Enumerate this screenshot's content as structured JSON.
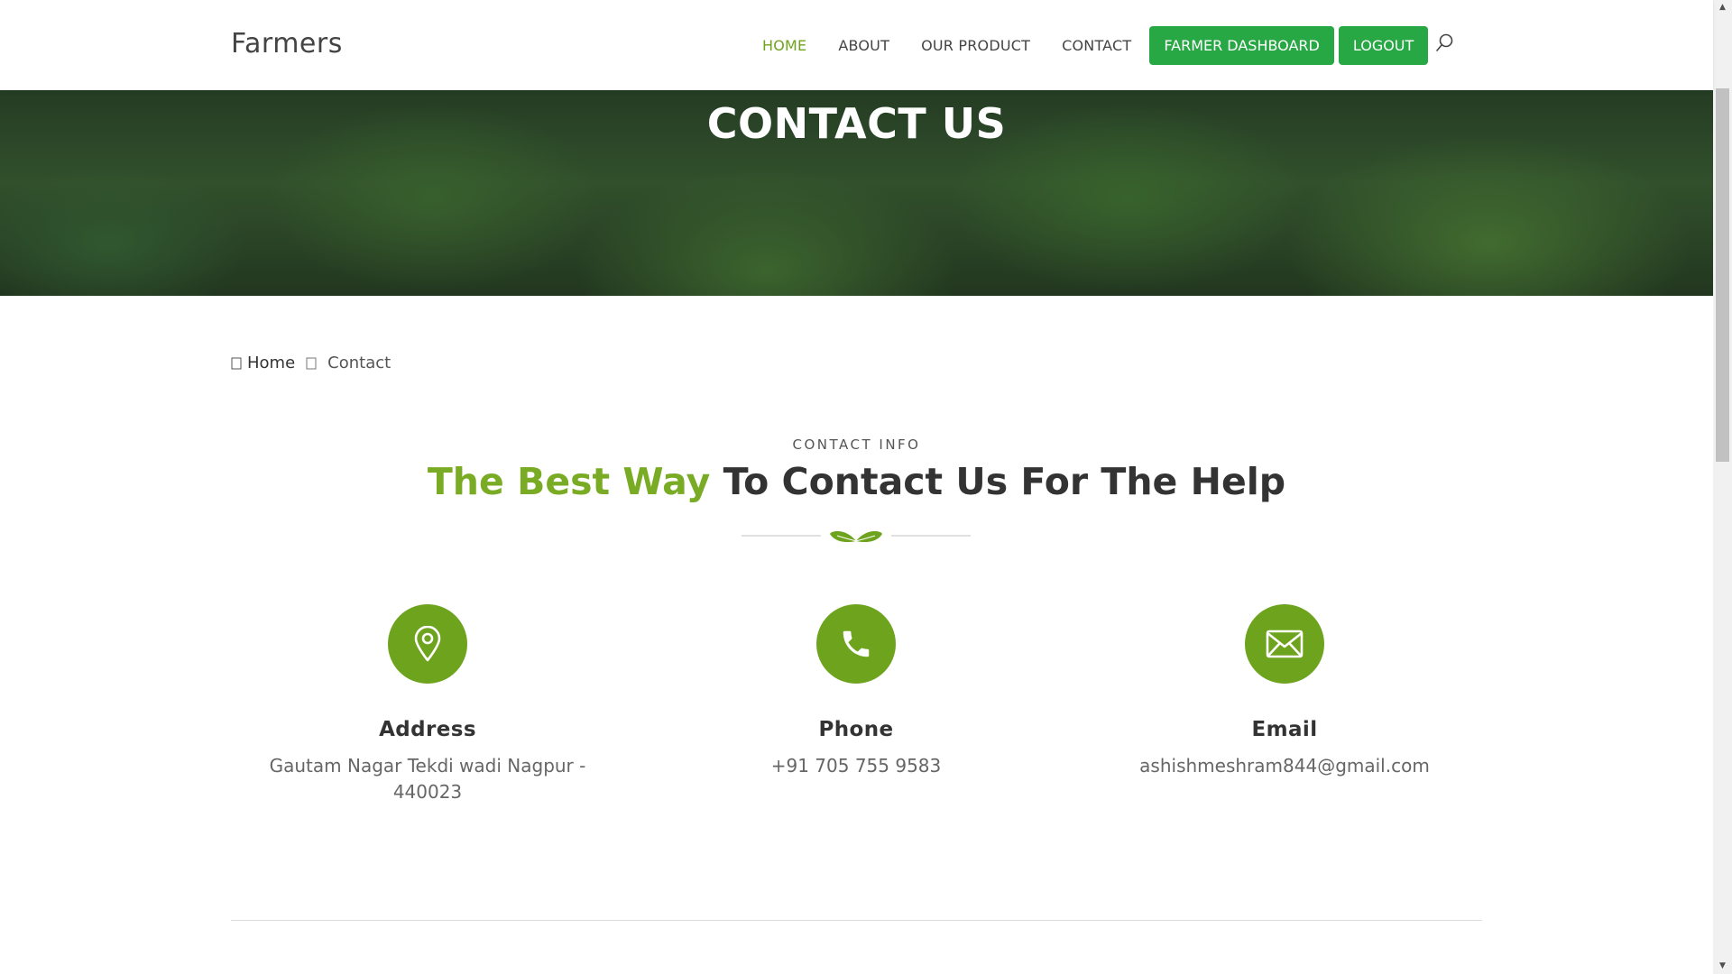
{
  "header": {
    "brand": "Farmers",
    "nav": [
      {
        "label": "HOME",
        "active": true
      },
      {
        "label": "ABOUT"
      },
      {
        "label": "OUR PRODUCT"
      },
      {
        "label": "CONTACT"
      }
    ],
    "dashboard_button": "FARMER DASHBOARD",
    "logout_button": "LOGOUT",
    "search_icon": "search-icon"
  },
  "hero": {
    "title": "CONTACT US"
  },
  "breadcrumb": {
    "home_icon": "home-icon",
    "home": "Home",
    "separator_icon": "chevron-right-icon",
    "current": "Contact"
  },
  "section": {
    "eyebrow": "CONTACT INFO",
    "heading_accent": "The Best Way",
    "heading_rest": " To Contact Us For The Help",
    "divider_icon": "leaf-icon"
  },
  "contact_info": [
    {
      "icon": "location-pin-icon",
      "title": "Address",
      "text": "Gautam Nagar Tekdi wadi Nagpur - 440023"
    },
    {
      "icon": "phone-icon",
      "title": "Phone",
      "text": "+91 705 755 9583"
    },
    {
      "icon": "envelope-icon",
      "title": "Email",
      "text": "ashishmeshram844@gmail.com"
    }
  ],
  "colors": {
    "accent": "#6ea31d",
    "button": "#28a745",
    "heading": "#333333"
  }
}
